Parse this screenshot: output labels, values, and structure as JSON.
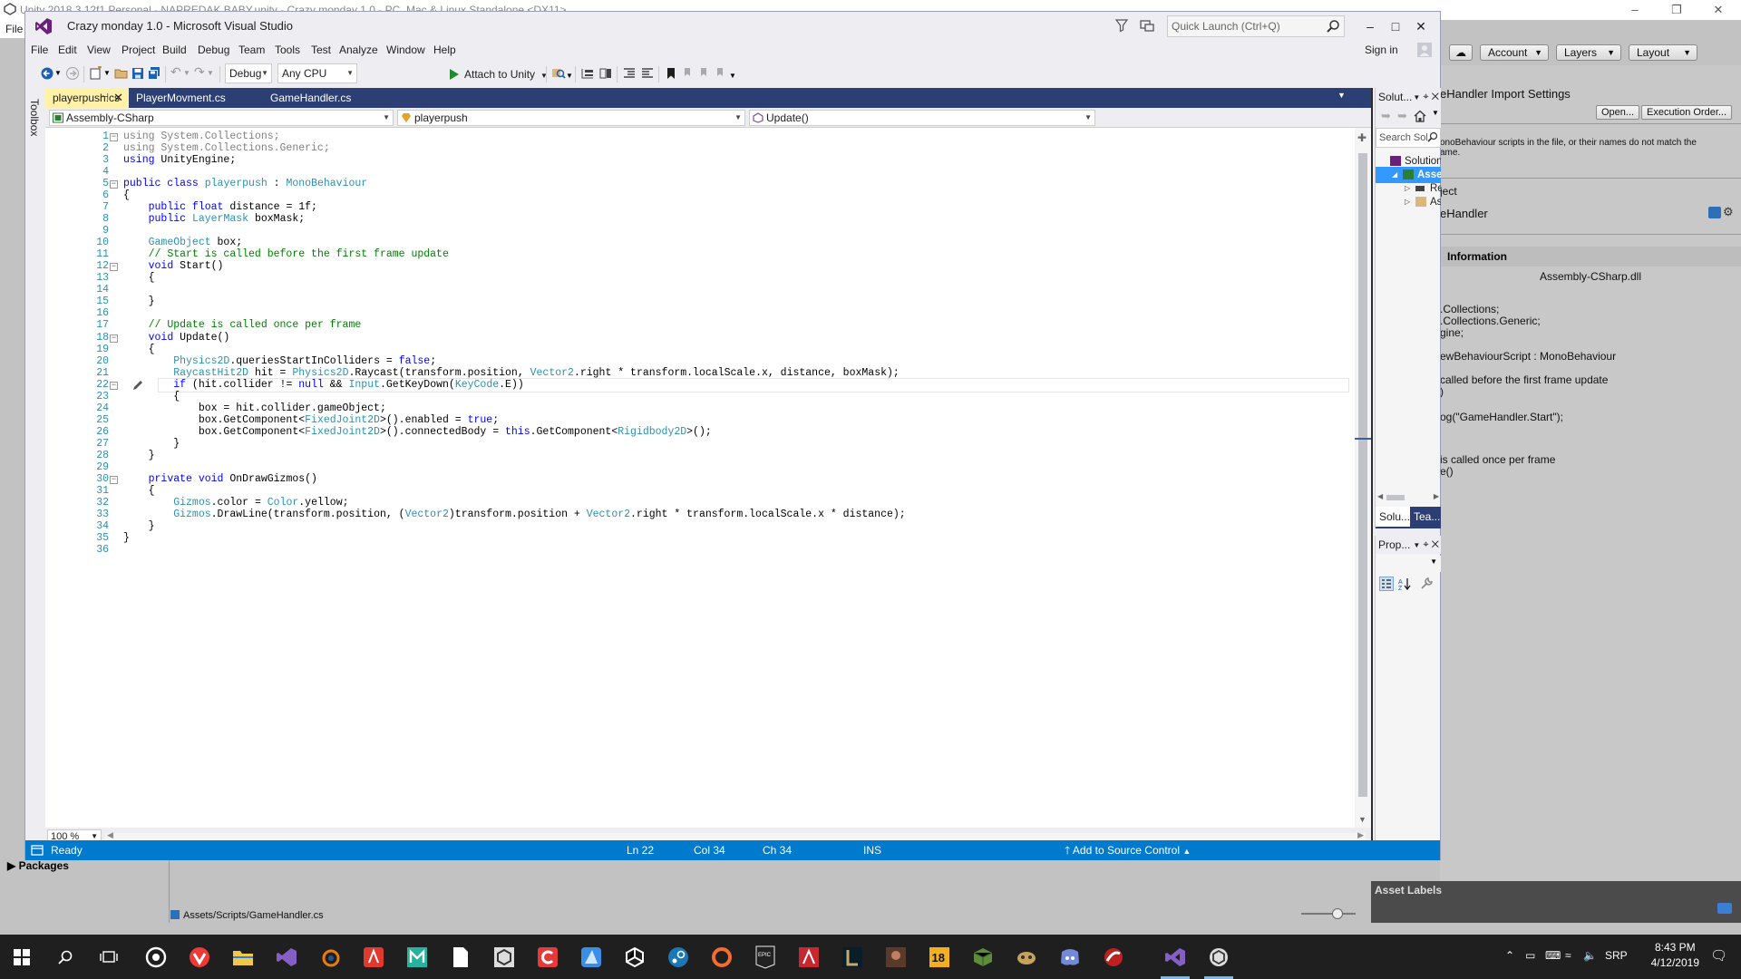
{
  "unity": {
    "title": "Unity 2018.3.12f1 Personal - NAPREDAK BABY.unity - Crazy monday 1.0 - PC, Mac & Linux Standalone <DX11>",
    "menu_file": "File",
    "toolbar": {
      "account": "Account",
      "layers": "Layers",
      "layout": "Layout"
    },
    "inspector": {
      "title": "eHandler Import Settings",
      "open_button": "Open...",
      "execution_order_button": "Execution Order...",
      "warning": "onoBehaviour scripts in the file, or their names do not match the",
      "warning2": "ame.",
      "project_label": "ject",
      "asset_name": "eHandler",
      "info_header": "Information",
      "dll_name": "Assembly-CSharp.dll",
      "preview_lines": [
        ".Collections;",
        ".Collections.Generic;",
        "gine;",
        "",
        "ewBehaviourScript : MonoBehaviour",
        "",
        "called before the first frame update",
        ")",
        "",
        "og(\"GameHandler.Start\");",
        "",
        "",
        "is called once per frame",
        "e()"
      ]
    },
    "asset_labels": "Asset Labels",
    "packages": "Packages",
    "asset_path": "Assets/Scripts/GameHandler.cs"
  },
  "vs": {
    "window_title": "Crazy monday 1.0 - Microsoft Visual Studio",
    "quick_launch_placeholder": "Quick Launch (Ctrl+Q)",
    "sign_in": "Sign in",
    "menu": [
      "File",
      "Edit",
      "View",
      "Project",
      "Build",
      "Debug",
      "Team",
      "Tools",
      "Test",
      "Analyze",
      "Window",
      "Help"
    ],
    "toolbar": {
      "config": "Debug",
      "platform": "Any CPU",
      "attach": "Attach to Unity"
    },
    "toolbox_label": "Toolbox",
    "tabs": [
      {
        "label": "playerpush.cs",
        "active": true
      },
      {
        "label": "PlayerMovment.cs",
        "active": false
      },
      {
        "label": "GameHandler.cs",
        "active": false
      }
    ],
    "nav": {
      "project": "Assembly-CSharp",
      "type": "playerpush",
      "member": "Update()"
    },
    "zoom": "100 %",
    "code_lines": [
      [
        [
          "g",
          "using System.Collections;"
        ]
      ],
      [
        [
          "g",
          "using System.Collections.Generic;"
        ]
      ],
      [
        [
          "k",
          "using"
        ],
        [
          "p",
          " UnityEngine;"
        ]
      ],
      [],
      [
        [
          "k",
          "public class"
        ],
        [
          "p",
          " "
        ],
        [
          "t",
          "playerpush"
        ],
        [
          "p",
          " : "
        ],
        [
          "t",
          "MonoBehaviour"
        ]
      ],
      [
        [
          "p",
          "{"
        ]
      ],
      [
        [
          "p",
          "    "
        ],
        [
          "k",
          "public float"
        ],
        [
          "p",
          " distance = 1f;"
        ]
      ],
      [
        [
          "p",
          "    "
        ],
        [
          "k",
          "public"
        ],
        [
          "p",
          " "
        ],
        [
          "t",
          "LayerMask"
        ],
        [
          "p",
          " boxMask;"
        ]
      ],
      [],
      [
        [
          "p",
          "    "
        ],
        [
          "t",
          "GameObject"
        ],
        [
          "p",
          " box;"
        ]
      ],
      [
        [
          "p",
          "    "
        ],
        [
          "c",
          "// Start is called before the first frame update"
        ]
      ],
      [
        [
          "p",
          "    "
        ],
        [
          "k",
          "void"
        ],
        [
          "p",
          " Start()"
        ]
      ],
      [
        [
          "p",
          "    {"
        ]
      ],
      [],
      [
        [
          "p",
          "    }"
        ]
      ],
      [],
      [
        [
          "p",
          "    "
        ],
        [
          "c",
          "// Update is called once per frame"
        ]
      ],
      [
        [
          "p",
          "    "
        ],
        [
          "k",
          "void"
        ],
        [
          "p",
          " Update()"
        ]
      ],
      [
        [
          "p",
          "    {"
        ]
      ],
      [
        [
          "p",
          "        "
        ],
        [
          "t",
          "Physics2D"
        ],
        [
          "p",
          ".queriesStartInColliders = "
        ],
        [
          "k",
          "false"
        ],
        [
          "p",
          ";"
        ]
      ],
      [
        [
          "p",
          "        "
        ],
        [
          "t",
          "RaycastHit2D"
        ],
        [
          "p",
          " hit = "
        ],
        [
          "t",
          "Physics2D"
        ],
        [
          "p",
          ".Raycast(transform.position, "
        ],
        [
          "t",
          "Vector2"
        ],
        [
          "p",
          ".right * transform.localScale.x, distance, boxMask);"
        ]
      ],
      [
        [
          "p",
          "        "
        ],
        [
          "k",
          "if"
        ],
        [
          "p",
          " (hit.collider != "
        ],
        [
          "k",
          "null"
        ],
        [
          "p",
          " && "
        ],
        [
          "t",
          "Input"
        ],
        [
          "p",
          ".GetKeyDown("
        ],
        [
          "t",
          "KeyCode"
        ],
        [
          "p",
          ".E))"
        ]
      ],
      [
        [
          "p",
          "        {"
        ]
      ],
      [
        [
          "p",
          "            box = hit.collider.gameObject;"
        ]
      ],
      [
        [
          "p",
          "            box.GetComponent<"
        ],
        [
          "t",
          "FixedJoint2D"
        ],
        [
          "p",
          ">().enabled = "
        ],
        [
          "k",
          "true"
        ],
        [
          "p",
          ";"
        ]
      ],
      [
        [
          "p",
          "            box.GetComponent<"
        ],
        [
          "t",
          "FixedJoint2D"
        ],
        [
          "p",
          ">().connectedBody = "
        ],
        [
          "k",
          "this"
        ],
        [
          "p",
          ".GetComponent<"
        ],
        [
          "t",
          "Rigidbody2D"
        ],
        [
          "p",
          ">();"
        ]
      ],
      [
        [
          "p",
          "        }"
        ]
      ],
      [
        [
          "p",
          "    }"
        ]
      ],
      [],
      [
        [
          "p",
          "    "
        ],
        [
          "k",
          "private void"
        ],
        [
          "p",
          " OnDrawGizmos()"
        ]
      ],
      [
        [
          "p",
          "    {"
        ]
      ],
      [
        [
          "p",
          "        "
        ],
        [
          "t",
          "Gizmos"
        ],
        [
          "p",
          ".color = "
        ],
        [
          "t",
          "Color"
        ],
        [
          "p",
          ".yellow;"
        ]
      ],
      [
        [
          "p",
          "        "
        ],
        [
          "t",
          "Gizmos"
        ],
        [
          "p",
          ".DrawLine(transform.position, ("
        ],
        [
          "t",
          "Vector2"
        ],
        [
          "p",
          ")transform.position + "
        ],
        [
          "t",
          "Vector2"
        ],
        [
          "p",
          ".right * transform.localScale.x * distance);"
        ]
      ],
      [
        [
          "p",
          "    }"
        ]
      ],
      [
        [
          "p",
          "}"
        ]
      ],
      []
    ],
    "fold_lines": [
      1,
      5,
      12,
      18,
      22,
      30
    ],
    "current_line": 22,
    "solution_explorer": {
      "title": "Solut...",
      "search_placeholder": "Search Solu",
      "items": [
        {
          "label": "Solution 'C",
          "indent": 0,
          "selected": false
        },
        {
          "label": "Assemb",
          "indent": 1,
          "selected": true
        },
        {
          "label": "Refe",
          "indent": 2,
          "selected": false
        },
        {
          "label": "Asse",
          "indent": 2,
          "selected": false
        }
      ],
      "tabs": [
        "Solu...",
        "Tea..."
      ]
    },
    "properties": {
      "title": "Prop..."
    },
    "status": {
      "ready": "Ready",
      "ln": "Ln 22",
      "col": "Col 34",
      "ch": "Ch 34",
      "mode": "INS",
      "source_control": "Add to Source Control"
    }
  },
  "taskbar": {
    "language": "SRP",
    "time": "8:43 PM",
    "date": "4/12/2019",
    "epic_label": "EPIC",
    "badge_18": "18"
  },
  "colors": {
    "vs_accent": "#007acc",
    "vs_tab_bar": "#2b3f74",
    "active_tab": "#fff1a8",
    "keyword": "#0000ff",
    "type": "#2b91af",
    "comment": "#008000"
  }
}
